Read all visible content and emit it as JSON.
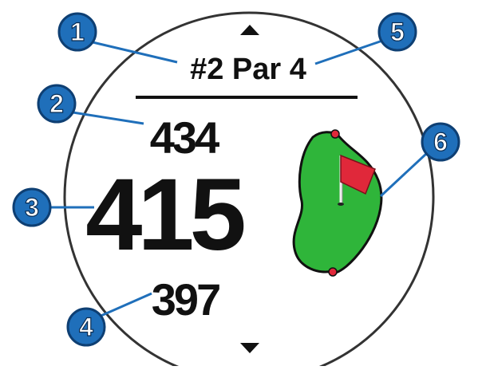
{
  "screen": {
    "hole_info": "#2 Par 4",
    "distance_back": "434",
    "distance_middle": "415",
    "distance_front": "397"
  },
  "callouts": [
    {
      "number": "1"
    },
    {
      "number": "2"
    },
    {
      "number": "3"
    },
    {
      "number": "4"
    },
    {
      "number": "5"
    },
    {
      "number": "6"
    }
  ],
  "icons": {
    "scroll_up": "triangle-up-icon",
    "scroll_down": "triangle-down-icon",
    "green": "green-map-icon",
    "flag": "flag-icon"
  },
  "colors": {
    "callout_fill": "#1f6fba",
    "callout_ring": "#0e3f73",
    "green": "#2fb53a",
    "flag": "#e0283a",
    "pin_dot": "#e0283a",
    "bezel": "#333333"
  }
}
